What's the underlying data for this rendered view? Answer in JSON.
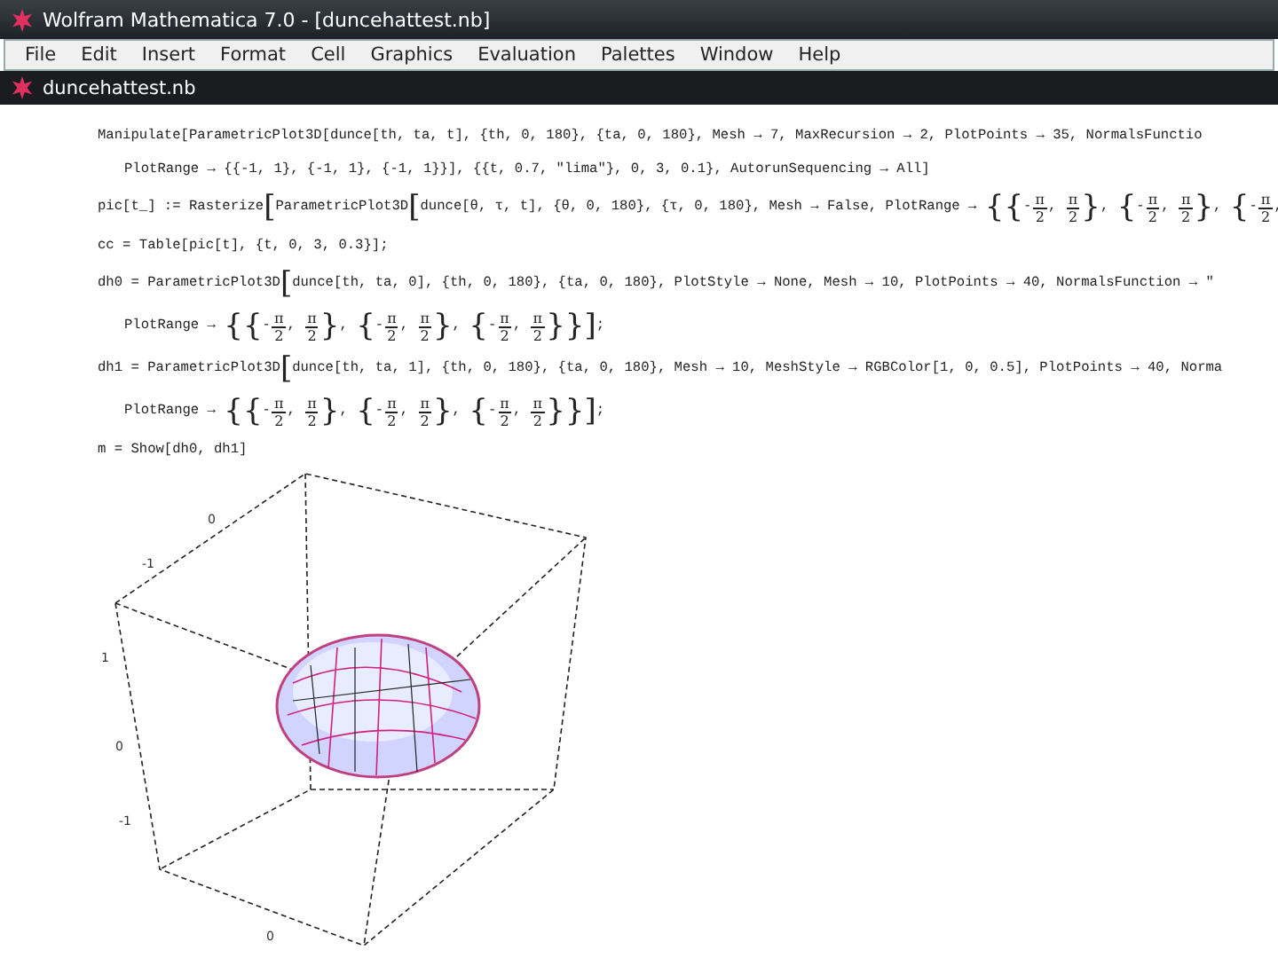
{
  "window": {
    "title": "Wolfram Mathematica 7.0 - [duncehattest.nb]"
  },
  "menu": [
    "File",
    "Edit",
    "Insert",
    "Format",
    "Cell",
    "Graphics",
    "Evaluation",
    "Palettes",
    "Window",
    "Help"
  ],
  "notebook_tab": {
    "title": "duncehattest.nb"
  },
  "cells": [
    {
      "kind": "input",
      "segments": [
        {
          "kind": "text",
          "text": "Manipulate[ParametricPlot3D[dunce[th, ta, t], {th, 0, 180}, {ta, 0, 180}, Mesh → 7, MaxRecursion → 2, PlotPoints → 35, NormalsFunctio"
        }
      ]
    },
    {
      "kind": "continuation",
      "segments": [
        {
          "kind": "text",
          "text": "PlotRange → {{-1, 1}, {-1, 1}, {-1, 1}}], {{t, 0.7, \"lima\"}, 0, 3, 0.1}, AutorunSequencing → All]"
        }
      ]
    },
    {
      "kind": "input",
      "segments": [
        {
          "kind": "text",
          "text": "pic[t_] := Rasterize"
        },
        {
          "kind": "big",
          "text": "["
        },
        {
          "kind": "text",
          "text": "ParametricPlot3D"
        },
        {
          "kind": "big",
          "text": "["
        },
        {
          "kind": "text",
          "text": "dunce[θ, τ, t], {θ, 0, 180}, {τ, 0, 180}, Mesh → False, PlotRange → "
        },
        {
          "kind": "big",
          "text": "{{"
        },
        {
          "kind": "text",
          "text": "-"
        },
        {
          "kind": "frac",
          "num": "π",
          "den": "2"
        },
        {
          "kind": "text",
          "text": ", "
        },
        {
          "kind": "frac",
          "num": "π",
          "den": "2"
        },
        {
          "kind": "big",
          "text": "}"
        },
        {
          "kind": "text",
          "text": ", "
        },
        {
          "kind": "big",
          "text": "{"
        },
        {
          "kind": "text",
          "text": "-"
        },
        {
          "kind": "frac",
          "num": "π",
          "den": "2"
        },
        {
          "kind": "text",
          "text": ", "
        },
        {
          "kind": "frac",
          "num": "π",
          "den": "2"
        },
        {
          "kind": "big",
          "text": "}"
        },
        {
          "kind": "text",
          "text": ", "
        },
        {
          "kind": "big",
          "text": "{"
        },
        {
          "kind": "text",
          "text": "-"
        },
        {
          "kind": "frac",
          "num": "π",
          "den": "2"
        },
        {
          "kind": "text",
          "text": ","
        }
      ]
    },
    {
      "kind": "input",
      "segments": [
        {
          "kind": "text",
          "text": "cc = Table[pic[t], {t, 0, 3, 0.3}];"
        }
      ]
    },
    {
      "kind": "input",
      "segments": [
        {
          "kind": "text",
          "text": "dh0 = ParametricPlot3D"
        },
        {
          "kind": "big",
          "text": "["
        },
        {
          "kind": "text",
          "text": "dunce[th, ta, 0], {th, 0, 180}, {ta, 0, 180}, PlotStyle → None, Mesh → 10, PlotPoints → 40, NormalsFunction → \""
        }
      ]
    },
    {
      "kind": "continuation",
      "segments": [
        {
          "kind": "text",
          "text": "PlotRange → "
        },
        {
          "kind": "big",
          "text": "{{"
        },
        {
          "kind": "text",
          "text": "-"
        },
        {
          "kind": "frac",
          "num": "π",
          "den": "2"
        },
        {
          "kind": "text",
          "text": ", "
        },
        {
          "kind": "frac",
          "num": "π",
          "den": "2"
        },
        {
          "kind": "big",
          "text": "}"
        },
        {
          "kind": "text",
          "text": ", "
        },
        {
          "kind": "big",
          "text": "{"
        },
        {
          "kind": "text",
          "text": "-"
        },
        {
          "kind": "frac",
          "num": "π",
          "den": "2"
        },
        {
          "kind": "text",
          "text": ", "
        },
        {
          "kind": "frac",
          "num": "π",
          "den": "2"
        },
        {
          "kind": "big",
          "text": "}"
        },
        {
          "kind": "text",
          "text": ", "
        },
        {
          "kind": "big",
          "text": "{"
        },
        {
          "kind": "text",
          "text": "-"
        },
        {
          "kind": "frac",
          "num": "π",
          "den": "2"
        },
        {
          "kind": "text",
          "text": ", "
        },
        {
          "kind": "frac",
          "num": "π",
          "den": "2"
        },
        {
          "kind": "big",
          "text": "}}]"
        },
        {
          "kind": "text",
          "text": ";"
        }
      ]
    },
    {
      "kind": "input",
      "segments": [
        {
          "kind": "text",
          "text": "dh1 = ParametricPlot3D"
        },
        {
          "kind": "big",
          "text": "["
        },
        {
          "kind": "text",
          "text": "dunce[th, ta, 1], {th, 0, 180}, {ta, 0, 180}, Mesh → 10, MeshStyle → RGBColor[1, 0, 0.5], PlotPoints → 40, Norma"
        }
      ]
    },
    {
      "kind": "continuation",
      "segments": [
        {
          "kind": "text",
          "text": "PlotRange → "
        },
        {
          "kind": "big",
          "text": "{{"
        },
        {
          "kind": "text",
          "text": "-"
        },
        {
          "kind": "frac",
          "num": "π",
          "den": "2"
        },
        {
          "kind": "text",
          "text": ", "
        },
        {
          "kind": "frac",
          "num": "π",
          "den": "2"
        },
        {
          "kind": "big",
          "text": "}"
        },
        {
          "kind": "text",
          "text": ", "
        },
        {
          "kind": "big",
          "text": "{"
        },
        {
          "kind": "text",
          "text": "-"
        },
        {
          "kind": "frac",
          "num": "π",
          "den": "2"
        },
        {
          "kind": "text",
          "text": ", "
        },
        {
          "kind": "frac",
          "num": "π",
          "den": "2"
        },
        {
          "kind": "big",
          "text": "}"
        },
        {
          "kind": "text",
          "text": ", "
        },
        {
          "kind": "big",
          "text": "{"
        },
        {
          "kind": "text",
          "text": "-"
        },
        {
          "kind": "frac",
          "num": "π",
          "den": "2"
        },
        {
          "kind": "text",
          "text": ", "
        },
        {
          "kind": "frac",
          "num": "π",
          "den": "2"
        },
        {
          "kind": "big",
          "text": "}}]"
        },
        {
          "kind": "text",
          "text": ";"
        }
      ]
    },
    {
      "kind": "input",
      "segments": [
        {
          "kind": "text",
          "text": "m = Show[dh0, dh1]"
        }
      ]
    }
  ],
  "plot": {
    "tick_labels": [
      "0",
      "-1",
      "1",
      "0",
      "-1",
      "0"
    ]
  }
}
